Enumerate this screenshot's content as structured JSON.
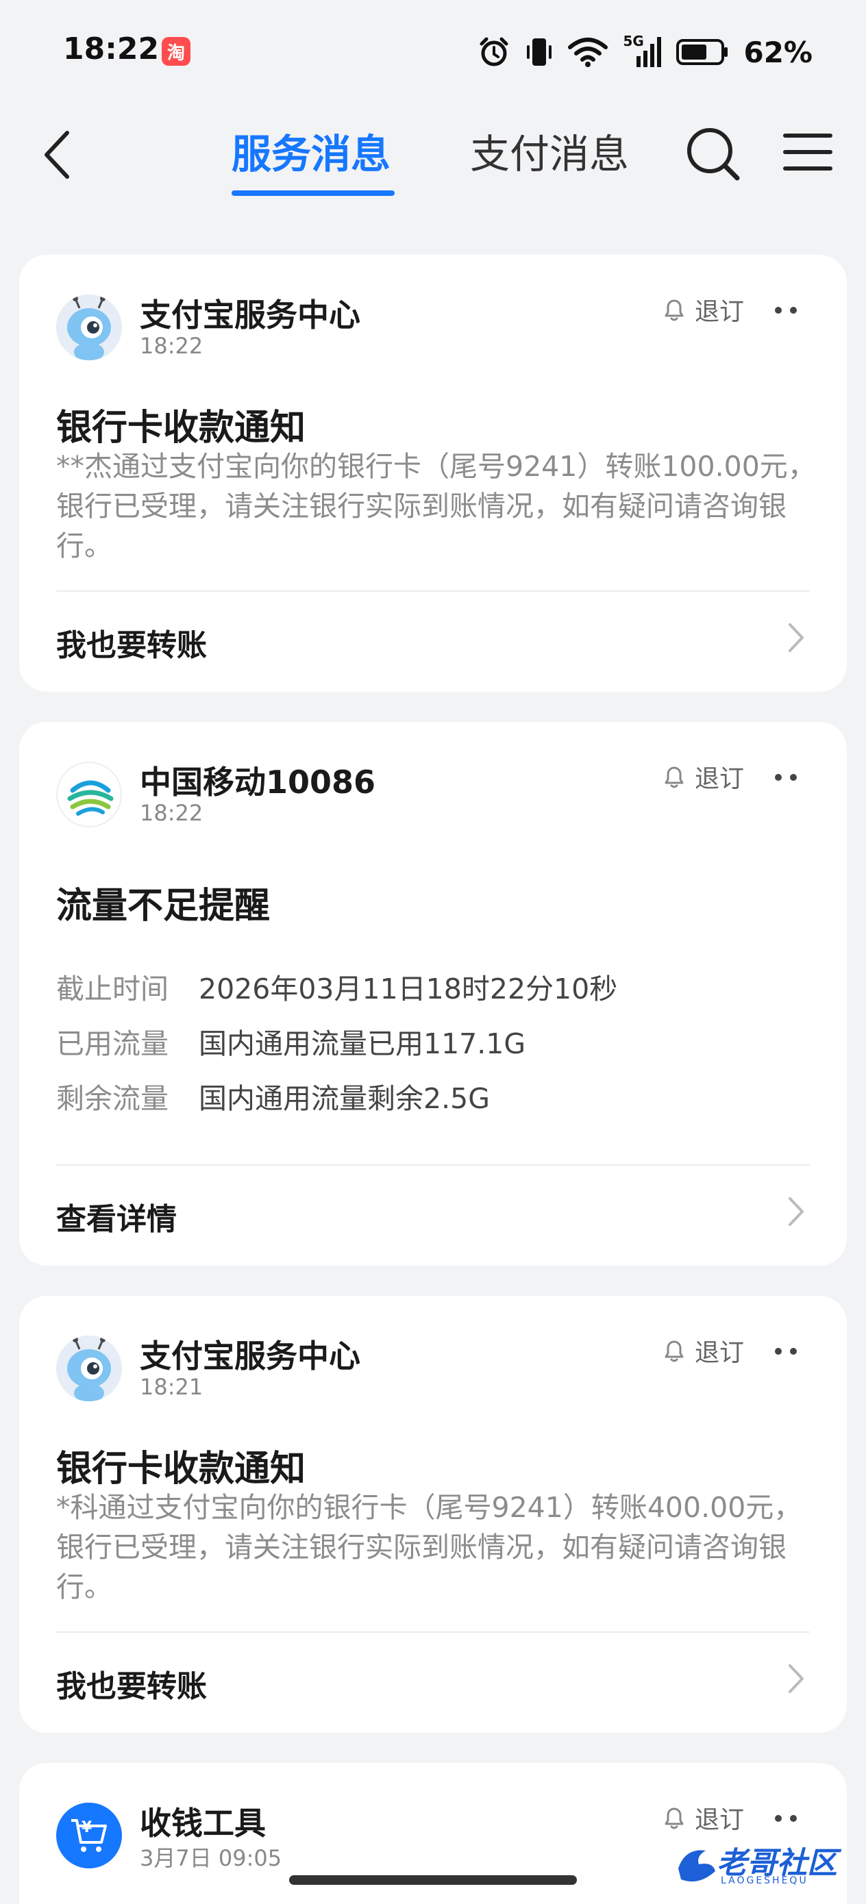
{
  "status_bar": {
    "time": "18:22",
    "app_icon_char": "淘",
    "network": "5G",
    "battery": "62%"
  },
  "nav": {
    "tab_active": "服务消息",
    "tab_other": "支付消息"
  },
  "colors": {
    "accent": "#1677ff",
    "background": "#f2f3f5",
    "card": "#ffffff",
    "muted_text": "#8c8c8c"
  },
  "cards": [
    {
      "sender": "支付宝服务中心",
      "time": "18:22",
      "unsubscribe": "退订",
      "title": "银行卡收款通知",
      "body": "**杰通过支付宝向你的银行卡（尾号9241）转账100.00元，银行已受理，请关注银行实际到账情况，如有疑问请咨询银行。",
      "action": "我也要转账"
    },
    {
      "sender": "中国移动10086",
      "time": "18:22",
      "unsubscribe": "退订",
      "title": "流量不足提醒",
      "rows": [
        {
          "k": "截止时间",
          "v": "2026年03月11日18时22分10秒"
        },
        {
          "k": "已用流量",
          "v": "国内通用流量已用117.1G"
        },
        {
          "k": "剩余流量",
          "v": "国内通用流量剩余2.5G"
        }
      ],
      "action": "查看详情"
    },
    {
      "sender": "支付宝服务中心",
      "time": "18:21",
      "unsubscribe": "退订",
      "title": "银行卡收款通知",
      "body": "*科通过支付宝向你的银行卡（尾号9241）转账400.00元，银行已受理，请关注银行实际到账情况，如有疑问请咨询银行。",
      "action": "我也要转账"
    },
    {
      "sender": "收钱工具",
      "time": "3月7日 09:05",
      "unsubscribe": "退订",
      "avatar_char": "¥"
    }
  ],
  "watermark": {
    "text": "老哥社区",
    "sub": "LAOGESHEQU"
  }
}
